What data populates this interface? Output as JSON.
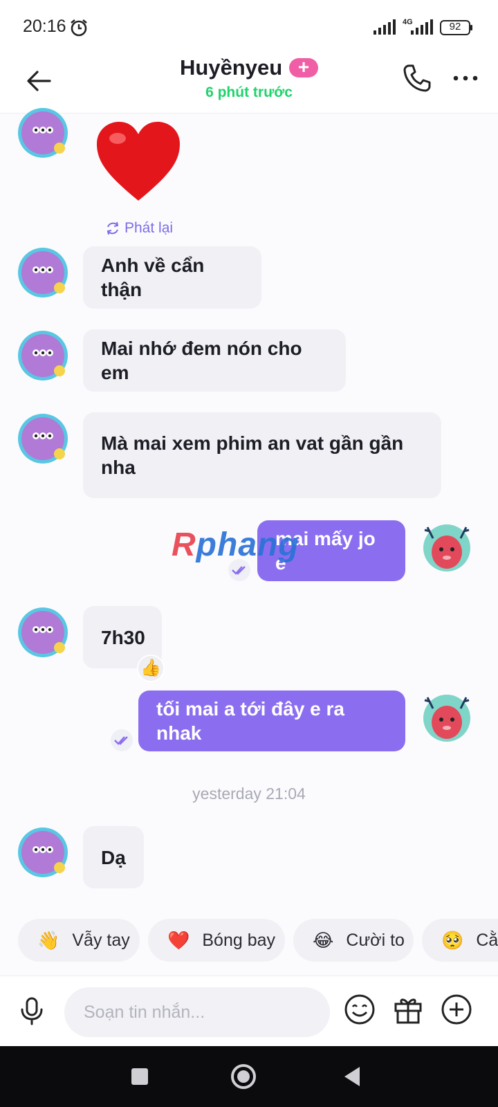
{
  "status": {
    "time": "20:16",
    "network": "4G",
    "battery": "92"
  },
  "header": {
    "name": "Huyềnyeu",
    "plus_badge": "+",
    "presence": "6 phút trước"
  },
  "messages": [
    {
      "type": "sticker",
      "sticker": "❤️",
      "replay_label": "Phát lại"
    },
    {
      "direction": "in",
      "text": "Anh về cẩn thận"
    },
    {
      "direction": "in",
      "text": "Mai nhớ đem nón cho em"
    },
    {
      "direction": "in",
      "text": "Mà mai xem phim an vat gần gần nha"
    },
    {
      "direction": "out",
      "text": "mai mấy jo e"
    },
    {
      "direction": "in",
      "text": "7h30",
      "reaction": "👍"
    },
    {
      "direction": "out",
      "text": "tối mai a tới đây e ra nhak"
    },
    {
      "type": "divider",
      "text": "yesterday 21:04"
    },
    {
      "direction": "in",
      "text": "Dạ"
    }
  ],
  "watermark": {
    "left": "R",
    "right": "phang"
  },
  "quick_replies": [
    {
      "emoji": "👋",
      "label": "Vẫy tay"
    },
    {
      "emoji": "❤️",
      "label": "Bóng bay"
    },
    {
      "emoji": "😂",
      "label": "Cười to"
    },
    {
      "emoji": "🥺",
      "label": "Cằ"
    }
  ],
  "composer": {
    "placeholder": "Soạn tin nhắn..."
  },
  "colors": {
    "accent": "#8b6ef0",
    "online": "#1fd36a",
    "badge": "#f05fa6",
    "incoming_bubble": "#f0f0f5"
  }
}
